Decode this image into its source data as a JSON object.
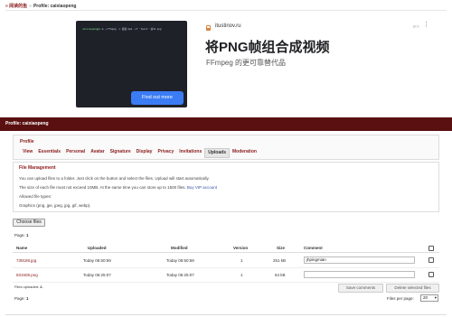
{
  "breadcrumb": {
    "home": "» 阅读的鱼",
    "separator": "»",
    "current": "Profile: caixiaopeng"
  },
  "ad": {
    "terminal_line": "~/ffmpeg -i 视频.mp4 -vf 'fps=1' 帧%d.png",
    "domain": "itustinov.ru",
    "ad_label": "ᐅᐳ",
    "menu_icon": "kebab-menu-icon",
    "title": "将PNG帧组合成视频",
    "subtitle": "FFmpeg 的更可靠替代品",
    "button": "Find out more"
  },
  "profile_bar": {
    "title": "Profile: caixiaopeng"
  },
  "profile_box": {
    "title": "Profile",
    "tabs": [
      {
        "label": "View",
        "active": false
      },
      {
        "label": "Essentials",
        "active": false
      },
      {
        "label": "Personal",
        "active": false
      },
      {
        "label": "Avatar",
        "active": false
      },
      {
        "label": "Signature",
        "active": false
      },
      {
        "label": "Display",
        "active": false
      },
      {
        "label": "Privacy",
        "active": false
      },
      {
        "label": "Invitations",
        "active": false
      },
      {
        "label": "Uploads",
        "active": true
      },
      {
        "label": "Moderation",
        "active": false
      }
    ]
  },
  "file_management": {
    "title": "File Management",
    "line1": "You can upload files to a folder. Just click on the button and select the files. Upload will start automatically.",
    "line2": "The size of each file must not exceed 10MB. At the same time you can store up to 1500 files.",
    "vip_link": "Buy VIP account",
    "line3": "Allowed file types:",
    "line4": "Graphics (png, jpe, jpeg, jpg, gif, webp)."
  },
  "choose_files": "Choose files",
  "page_top": {
    "label": "Page:",
    "value": "1"
  },
  "table": {
    "headers": {
      "name": "Name",
      "uploaded": "Uploaded",
      "modified": "Modified",
      "version": "Version",
      "size": "Size",
      "comment": "Comment"
    },
    "rows": [
      {
        "name": "739188.jpg",
        "uploaded": "Today 06:50:59",
        "modified": "Today 06:50:59",
        "version": "1",
        "size": "251 kB",
        "comment": "jhpingmian"
      },
      {
        "name": "831508.png",
        "uploaded": "Today 06:25:07",
        "modified": "Today 06:25:07",
        "version": "1",
        "size": "54 kB",
        "comment": ""
      }
    ]
  },
  "files_uploaded": {
    "label": "Files uploaded:",
    "value": "2."
  },
  "save_comments": "Save comments",
  "delete_selected": "Delete selected files",
  "page_bottom": {
    "label": "Page:",
    "value": "1"
  },
  "per_page": {
    "label": "Files per page:",
    "value": "20"
  }
}
